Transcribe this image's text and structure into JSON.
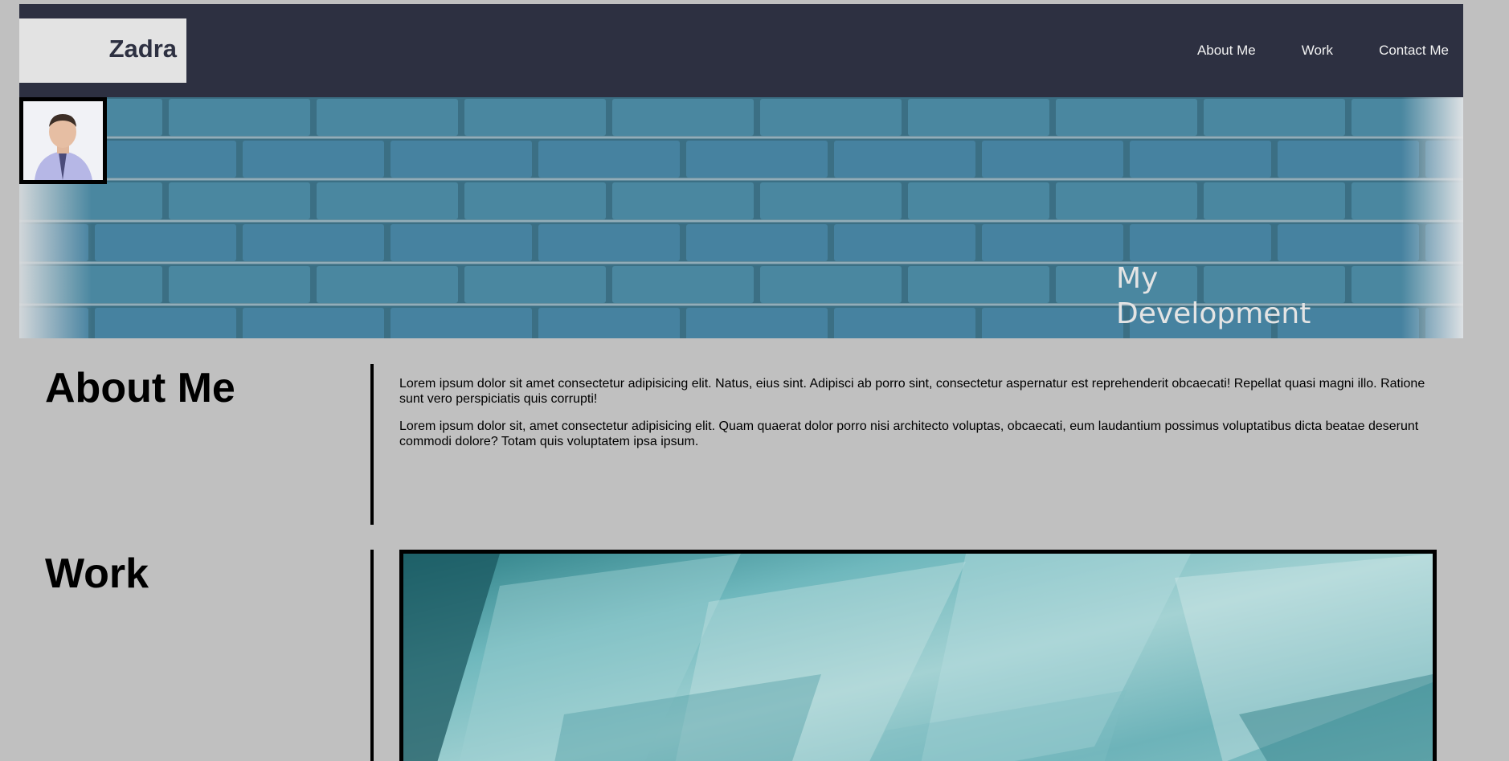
{
  "header": {
    "logo": "Zadra",
    "nav": [
      "About Me",
      "Work",
      "Contact Me"
    ]
  },
  "hero": {
    "title": "My Development"
  },
  "about": {
    "heading": "About Me",
    "paragraphs": [
      "Lorem ipsum dolor sit amet consectetur adipisicing elit. Natus, eius sint. Adipisci ab porro sint, consectetur aspernatur est reprehenderit obcaecati! Repellat quasi magni illo. Ratione sunt vero perspiciatis quis corrupti!",
      "Lorem ipsum dolor sit, amet consectetur adipisicing elit. Quam quaerat dolor porro nisi architecto voluptas, obcaecati, eum laudantium possimus voluptatibus dicta beatae deserunt commodi dolore? Totam quis voluptatem ipsa ipsum."
    ]
  },
  "work": {
    "heading": "Work"
  },
  "colors": {
    "header_bg": "#2d3041",
    "page_bg": "#c0c0c0",
    "brick": "#3f7d95",
    "paint": "#5aa9b0"
  }
}
